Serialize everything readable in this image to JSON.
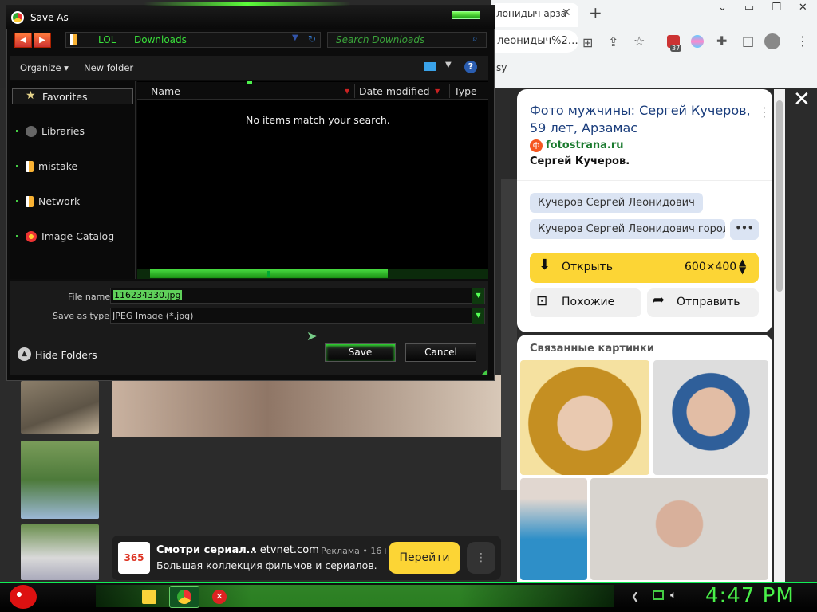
{
  "browser": {
    "tab_title": "лонидыч арза",
    "tab_close": "✕",
    "new_tab": "+",
    "address": "леонидыч%2…",
    "bookmark_fragment": "sy",
    "extension_badge": "37"
  },
  "viewer": {
    "close": "✕",
    "ad": {
      "logo": "365",
      "title": "Смотри сериал…",
      "domain": "• etvnet.com",
      "label": "Реклама • 16+",
      "description": "Большая коллекция фильмов и сериалов. Д…",
      "button": "Перейти",
      "more": "⋮"
    }
  },
  "panel": {
    "title": "Фото мужчины: Сергей Кучеров, 59 лет, Арзамас",
    "menu": "⋮",
    "source_icon": "ф",
    "source": "fotostrana.ru",
    "caption": "Сергей Кучеров.",
    "chips": [
      "Кучеров Сергей Леонидович",
      "Кучеров Сергей Леонидович город…"
    ],
    "chips_more": "•••",
    "open_label": "Открыть",
    "size": "600×400",
    "similar": "Похожие",
    "share": "Отправить",
    "related_title": "Связанные картинки"
  },
  "dialog": {
    "title": "Save As",
    "path": [
      "LOL",
      "Downloads"
    ],
    "search_placeholder": "Search Downloads",
    "organize": "Organize ▾",
    "new_folder": "New folder",
    "help": "?",
    "favorites": "Favorites",
    "nav_items": [
      "Libraries",
      "mistake",
      "Network",
      "Image Catalog"
    ],
    "columns": [
      "Name",
      "Date modified",
      "Type"
    ],
    "empty_message": "No items match your search.",
    "file_name_label": "File name:",
    "file_name": "116234330.jpg",
    "save_type_label": "Save as type:",
    "save_type": "JPEG Image (*.jpg)",
    "hide_folders": "Hide Folders",
    "save": "Save",
    "cancel": "Cancel"
  },
  "taskbar": {
    "clock": "4:47 PM"
  },
  "colors": {
    "accent_green": "#49f049",
    "yandex_yellow": "#fcd535",
    "title_blue": "#1a3d7c"
  }
}
